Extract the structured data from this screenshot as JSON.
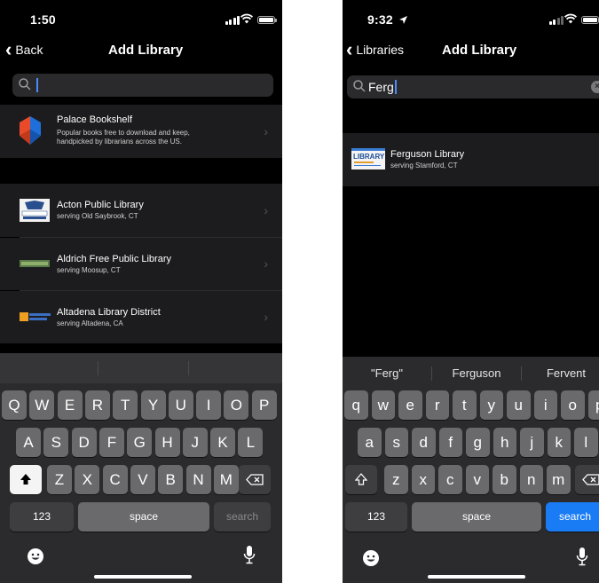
{
  "screen_a": {
    "status": {
      "time": "1:50"
    },
    "nav": {
      "back": "Back",
      "title": "Add Library"
    },
    "search": {
      "value": ""
    },
    "featured": {
      "name": "Palace Bookshelf",
      "desc_line1": "Popular books free to download and keep,",
      "desc_line2": "handpicked by librarians across the US."
    },
    "libraries": [
      {
        "name": "Acton Public Library",
        "sub": "serving Old Saybrook, CT"
      },
      {
        "name": "Aldrich Free Public Library",
        "sub": "serving Moosup, CT"
      },
      {
        "name": "Altadena Library District",
        "sub": "serving Altadena, CA"
      }
    ],
    "keyboard": {
      "row1": [
        "Q",
        "W",
        "E",
        "R",
        "T",
        "Y",
        "U",
        "I",
        "O",
        "P"
      ],
      "row2": [
        "A",
        "S",
        "D",
        "F",
        "G",
        "H",
        "J",
        "K",
        "L"
      ],
      "row3": [
        "Z",
        "X",
        "C",
        "V",
        "B",
        "N",
        "M"
      ],
      "numbers": "123",
      "space": "space",
      "action": "search"
    }
  },
  "screen_b": {
    "status": {
      "time": "9:32"
    },
    "nav": {
      "back": "Libraries",
      "title": "Add Library"
    },
    "search": {
      "value": "Ferg"
    },
    "results": [
      {
        "name": "Ferguson Library",
        "sub": "serving Stamford, CT",
        "logo_text": "LIBRARY"
      }
    ],
    "suggestions": [
      "\"Ferg\"",
      "Ferguson",
      "Fervent"
    ],
    "keyboard": {
      "row1": [
        "q",
        "w",
        "e",
        "r",
        "t",
        "y",
        "u",
        "i",
        "o",
        "p"
      ],
      "row2": [
        "a",
        "s",
        "d",
        "f",
        "g",
        "h",
        "j",
        "k",
        "l"
      ],
      "row3": [
        "z",
        "x",
        "c",
        "v",
        "b",
        "n",
        "m"
      ],
      "numbers": "123",
      "space": "space",
      "action": "search"
    }
  },
  "colors": {
    "accent": "#1a7cf5",
    "cell": "#1c1c1e",
    "keyboard": "#2b2b2d"
  }
}
